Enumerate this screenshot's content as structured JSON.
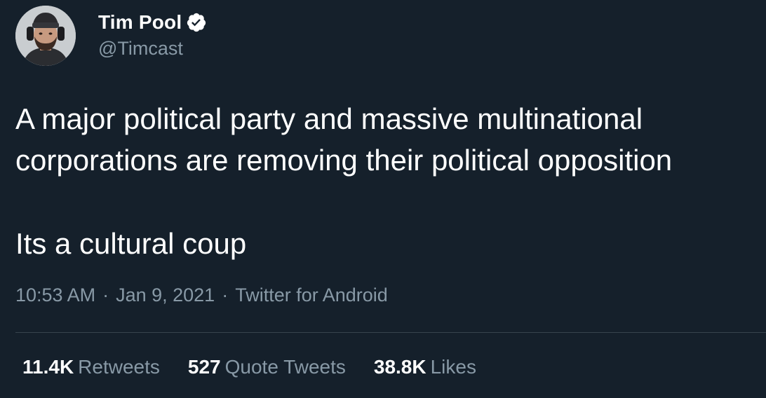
{
  "author": {
    "display_name": "Tim Pool",
    "handle": "@Timcast",
    "verified": true,
    "avatar_icon": "profile-photo"
  },
  "tweet": {
    "line1": "A major political party and massive multinational",
    "line2": "corporations are removing their political opposition",
    "para2": "Its a cultural coup"
  },
  "meta": {
    "time": "10:53 AM",
    "date": "Jan 9, 2021",
    "source": "Twitter for Android",
    "separator": "·"
  },
  "stats": {
    "retweets_count": "11.4K",
    "retweets_label": "Retweets",
    "quotes_count": "527",
    "quotes_label": "Quote Tweets",
    "likes_count": "38.8K",
    "likes_label": "Likes"
  },
  "colors": {
    "background": "#15202b",
    "primary_text": "#ffffff",
    "secondary_text": "#8899a6",
    "divider": "#38444d"
  }
}
